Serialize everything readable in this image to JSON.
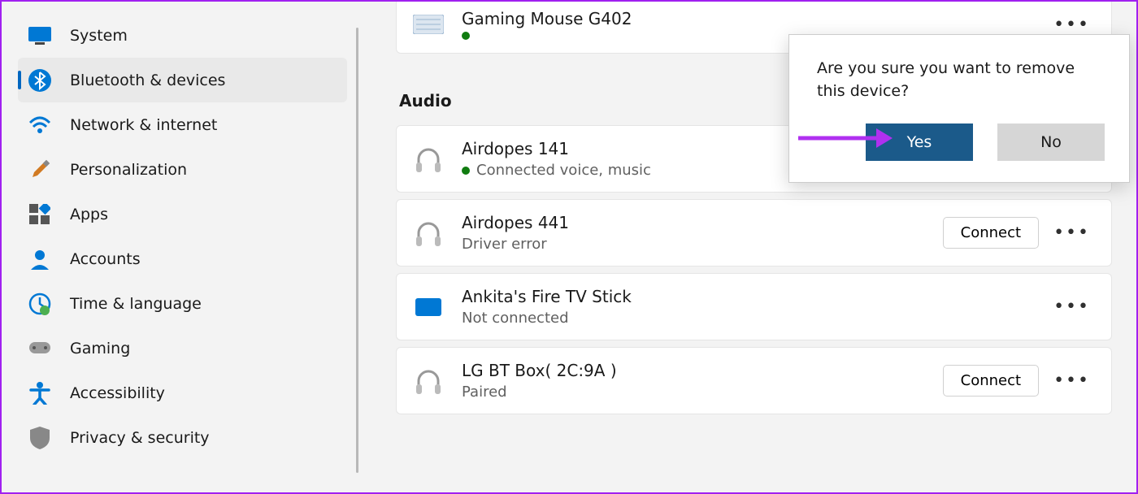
{
  "sidebar": {
    "items": [
      {
        "label": "System"
      },
      {
        "label": "Bluetooth & devices"
      },
      {
        "label": "Network & internet"
      },
      {
        "label": "Personalization"
      },
      {
        "label": "Apps"
      },
      {
        "label": "Accounts"
      },
      {
        "label": "Time & language"
      },
      {
        "label": "Gaming"
      },
      {
        "label": "Accessibility"
      },
      {
        "label": "Privacy & security"
      }
    ]
  },
  "section": {
    "audio_title": "Audio"
  },
  "devices": {
    "mouse": {
      "name": "Gaming Mouse G402"
    },
    "airdopes141": {
      "name": "Airdopes 141",
      "status": "Connected voice, music"
    },
    "airdopes441": {
      "name": "Airdopes 441",
      "status": "Driver error",
      "connect": "Connect"
    },
    "firetv": {
      "name": "Ankita's Fire TV Stick",
      "status": "Not connected"
    },
    "lgbt": {
      "name": "LG BT Box( 2C:9A )",
      "status": "Paired",
      "connect": "Connect"
    }
  },
  "popup": {
    "text": "Are you sure you want to remove this device?",
    "yes": "Yes",
    "no": "No"
  },
  "more_label": "•••"
}
